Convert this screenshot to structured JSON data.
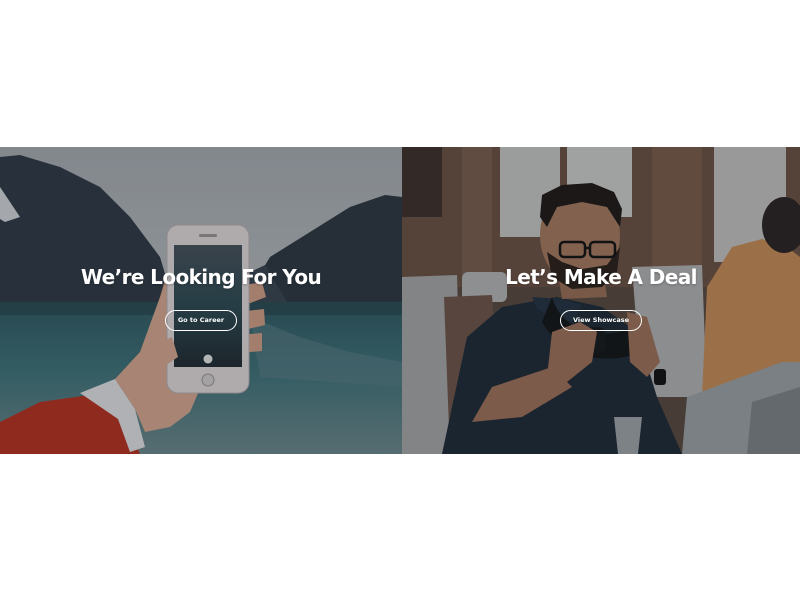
{
  "panels": [
    {
      "title": "We’re Looking For You",
      "button_label": "Go to Career",
      "image": "hand-holding-phone-by-mountain-lake"
    },
    {
      "title": "Let’s Make A Deal",
      "button_label": "View Showcase",
      "image": "man-with-headphones-at-laptop"
    }
  ],
  "colors": {
    "page_background": "#ffffff",
    "text": "#ffffff",
    "lake": "#3b6b73",
    "sky": "#b5babd",
    "sleeve": "#b8301f"
  }
}
